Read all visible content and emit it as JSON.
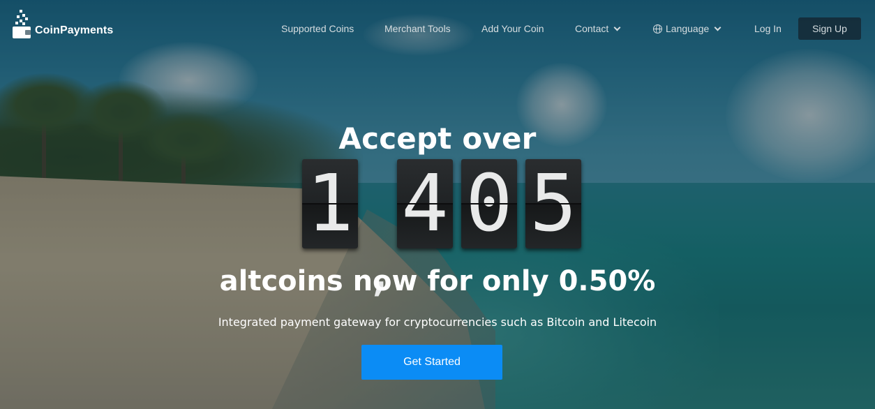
{
  "brand": {
    "name": "CoinPayments"
  },
  "nav": {
    "items": [
      {
        "label": "Supported Coins"
      },
      {
        "label": "Merchant Tools"
      },
      {
        "label": "Add Your Coin"
      },
      {
        "label": "Contact",
        "icon": "chevron-down-icon"
      },
      {
        "label": "Language",
        "icon": "globe-icon"
      }
    ],
    "login": "Log In",
    "signup": "Sign Up"
  },
  "hero": {
    "title": "Accept over",
    "counter": {
      "digits": [
        "1",
        "4",
        "0",
        "5"
      ],
      "separator": ","
    },
    "subtitle": "altcoins now for only 0.50%",
    "description": "Integrated payment gateway for cryptocurrencies such as Bitcoin and Litecoin",
    "cta": "Get Started"
  },
  "colors": {
    "cta": "#0b8cf5",
    "signup_bg": "#14232d",
    "flip_card": "#202325",
    "nav_text": "#d6dde0"
  }
}
